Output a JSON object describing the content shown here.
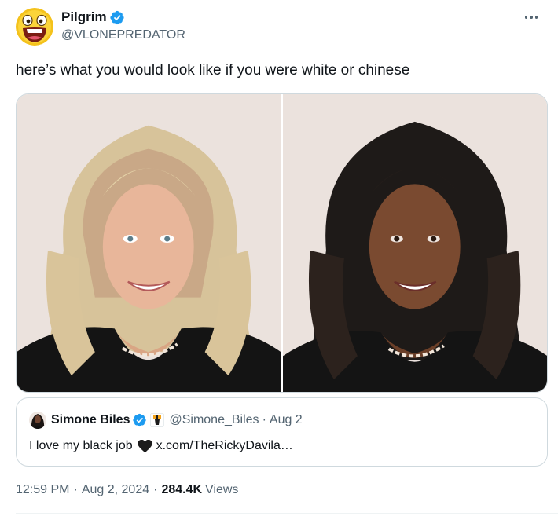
{
  "tweet": {
    "author": {
      "display_name": "Pilgrim",
      "handle": "@VLONEPREDATOR",
      "avatar_icon": "laughing-emoji-avatar",
      "verified_color": "#1d9bf0"
    },
    "more_icon": "more-horizontal-icon",
    "text": "here’s what you would look like if you were white or chinese",
    "media": [
      {
        "icon": "photo-blonde-woman"
      },
      {
        "icon": "photo-dark-haired-woman"
      }
    ],
    "quote": {
      "display_name": "Simone Biles",
      "handle": "@Simone_Biles",
      "separator": "·",
      "date": "Aug 2",
      "text_before": "I love my black job",
      "emoji": "black-heart-icon",
      "link_text": "x.com/TheRickyDavila…"
    },
    "meta": {
      "time": "12:59 PM",
      "sep": "·",
      "date": "Aug 2, 2024",
      "views_count": "284.4K",
      "views_label": "Views"
    }
  }
}
